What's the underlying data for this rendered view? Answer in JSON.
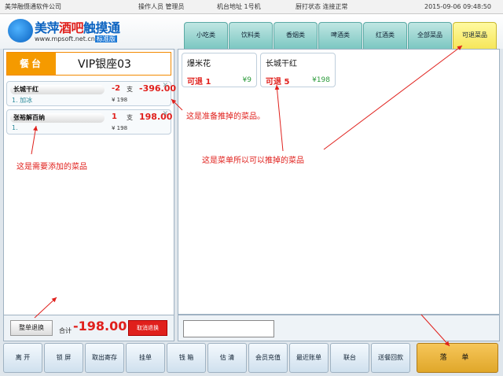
{
  "topbar": {
    "company": "美萍融慑通软件公司",
    "operator": "操作人员 管理员",
    "terminal": "机台地址 1号机",
    "print_status": "厨打状态 连接正常",
    "datetime": "2015-09-06 09:48:50"
  },
  "logo": {
    "title_part1": "美萍",
    "title_part2": "酒吧",
    "title_part3": "触摸通",
    "url": "www.mpsoft.net.cn",
    "edition": "标准版"
  },
  "category_tabs": [
    {
      "label": "小吃类",
      "active": false
    },
    {
      "label": "饮料类",
      "active": false
    },
    {
      "label": "香烟类",
      "active": false
    },
    {
      "label": "啤酒类",
      "active": false
    },
    {
      "label": "红酒类",
      "active": false
    },
    {
      "label": "全部菜品",
      "active": false
    },
    {
      "label": "可退菜品",
      "active": true
    }
  ],
  "table": {
    "label": "餐台",
    "name": "VIP银座03"
  },
  "order_items": [
    {
      "name": "长城干红",
      "qty": "-2",
      "unit": "支",
      "amount": "-396.00",
      "note": "1. 加冰",
      "price": "¥ 198"
    },
    {
      "name": "张裕解百纳",
      "qty": "1",
      "unit": "支",
      "amount": "198.00",
      "note": "1.",
      "price": "¥ 198"
    }
  ],
  "annotations": {
    "pending_return": "这是准备推掉的菜品。",
    "to_add": "这是需要添加的菜品",
    "returnable": "这是菜单所以可以推掉的菜品"
  },
  "dish_cards": [
    {
      "name": "爆米花",
      "ret_label": "可退 1",
      "price": "¥9"
    },
    {
      "name": "长城干红",
      "ret_label": "可退 5",
      "price": "¥198"
    }
  ],
  "left_footer": {
    "return_all": "整单退换",
    "total_label": "合计",
    "total_value": "-198.00",
    "cancel_return": "取消退换"
  },
  "right_footer": {
    "input_value": ""
  },
  "bottom_buttons": [
    "离 开",
    "锁 屏",
    "取出寄存",
    "挂单",
    "钱 箱",
    "估 清",
    "会员充值",
    "最近账单",
    "联台",
    "送餐回款"
  ],
  "checkout_label": "落 单",
  "colors": {
    "accent_orange": "#f59a00",
    "return_red": "#e0201c",
    "tab_teal": "#7cc7c2",
    "tab_active": "#f6e65a",
    "checkout": "#e0a72a"
  }
}
